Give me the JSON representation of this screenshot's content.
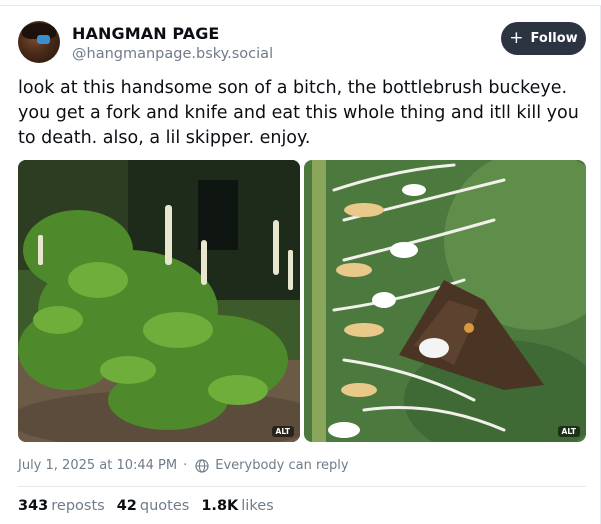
{
  "author": {
    "display_name": "HANGMAN PAGE",
    "handle": "@hangmanpage.bsky.social"
  },
  "follow_button": {
    "label": "Follow",
    "icon": "plus-icon"
  },
  "post": {
    "text": "look at this handsome son of a bitch, the bottlebrush buckeye.  you get a fork and knife and eat this whole thing and itll kill you to death.  also, a lil skipper.  enjoy.",
    "images": [
      {
        "alt_badge": "ALT"
      },
      {
        "alt_badge": "ALT"
      }
    ],
    "timestamp": "July 1, 2025 at 10:44 PM",
    "reply_setting": "Everybody can reply"
  },
  "stats": {
    "reposts": {
      "count": "343",
      "label": "reposts"
    },
    "quotes": {
      "count": "42",
      "label": "quotes"
    },
    "likes": {
      "count": "1.8K",
      "label": "likes"
    }
  },
  "colors": {
    "follow_bg": "#2b3440",
    "muted_text": "#6f7c8a",
    "divider": "#e6e9ee"
  }
}
